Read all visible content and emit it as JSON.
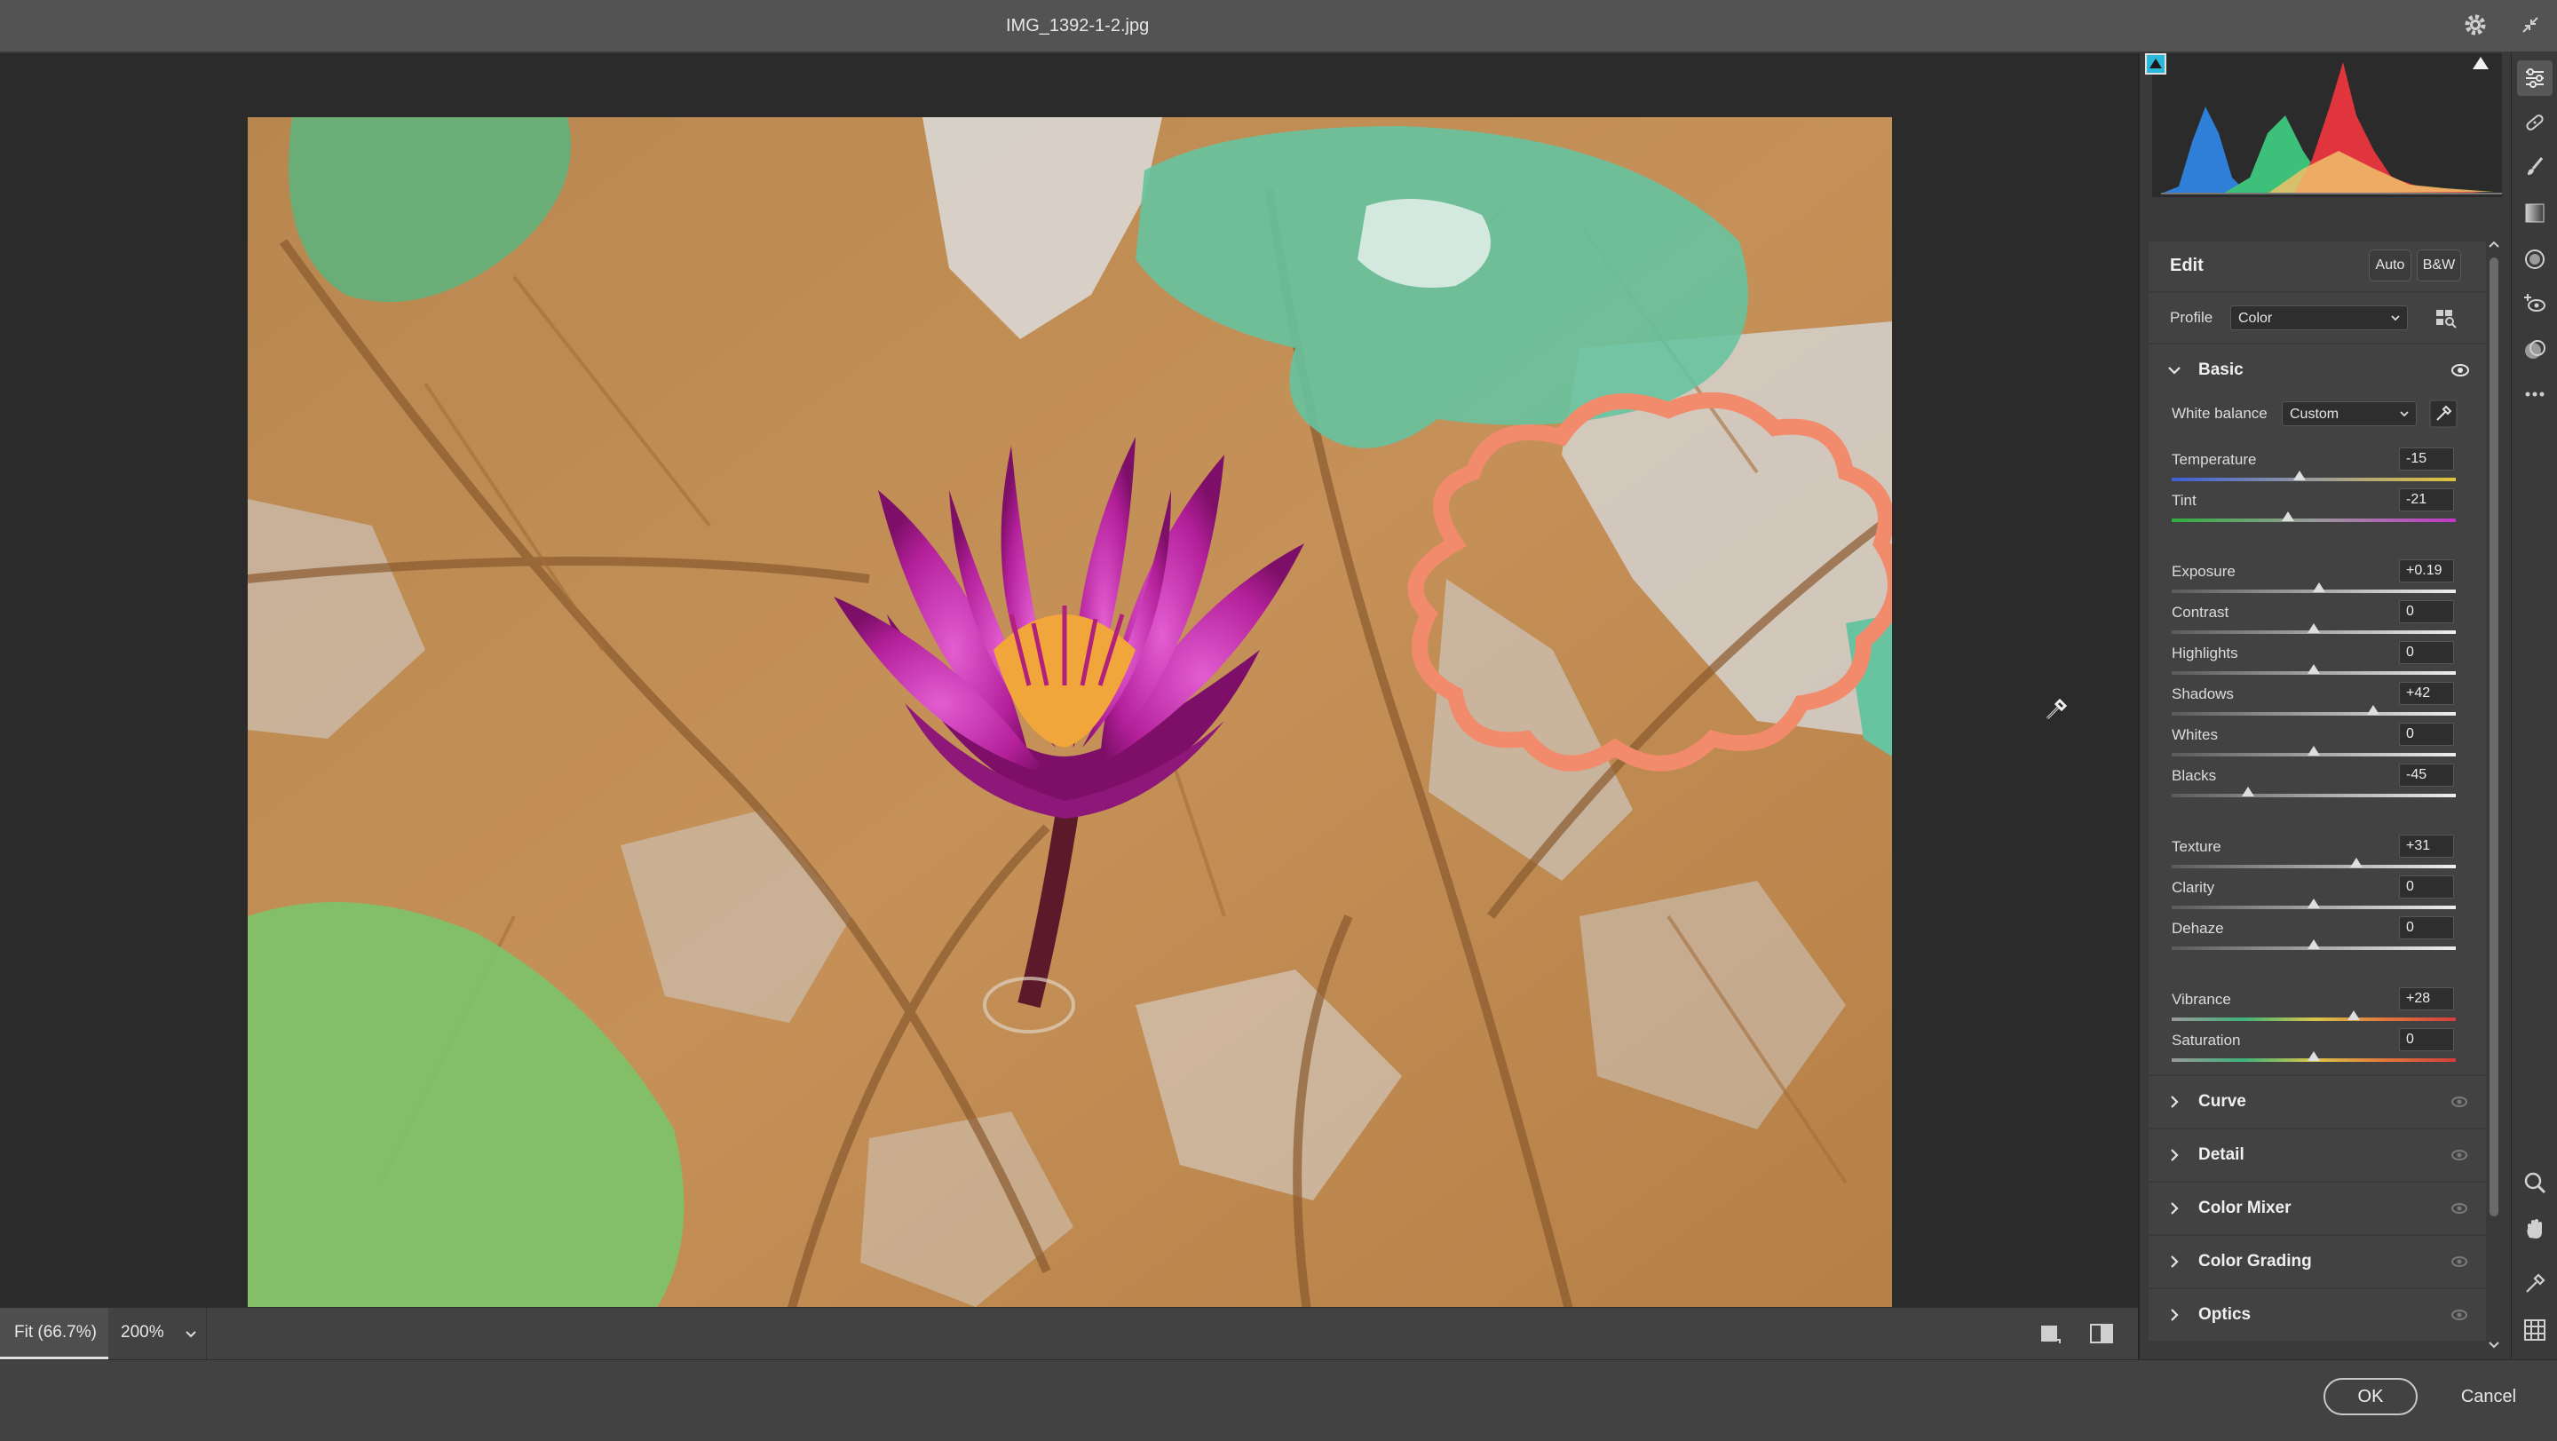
{
  "window": {
    "title": "IMG_1392-1-2.jpg"
  },
  "panel": {
    "edit": {
      "title": "Edit",
      "auto_label": "Auto",
      "bw_label": "B&W"
    },
    "profile": {
      "label": "Profile",
      "value": "Color"
    },
    "basic": {
      "title": "Basic",
      "white_balance": {
        "label": "White balance",
        "value": "Custom"
      },
      "sliders": [
        {
          "label": "Temperature",
          "value": "-15",
          "position": 0.45,
          "gradient": "temp"
        },
        {
          "label": "Tint",
          "value": "-21",
          "position": 0.41,
          "gradient": "tint"
        },
        {
          "label": "Exposure",
          "value": "+0.19",
          "position": 0.52,
          "gradient": "gray"
        },
        {
          "label": "Contrast",
          "value": "0",
          "position": 0.5,
          "gradient": "gray"
        },
        {
          "label": "Highlights",
          "value": "0",
          "position": 0.5,
          "gradient": "gray"
        },
        {
          "label": "Shadows",
          "value": "+42",
          "position": 0.71,
          "gradient": "gray"
        },
        {
          "label": "Whites",
          "value": "0",
          "position": 0.5,
          "gradient": "gray"
        },
        {
          "label": "Blacks",
          "value": "-45",
          "position": 0.27,
          "gradient": "gray"
        },
        {
          "label": "Texture",
          "value": "+31",
          "position": 0.65,
          "gradient": "gray"
        },
        {
          "label": "Clarity",
          "value": "0",
          "position": 0.5,
          "gradient": "gray"
        },
        {
          "label": "Dehaze",
          "value": "0",
          "position": 0.5,
          "gradient": "gray"
        },
        {
          "label": "Vibrance",
          "value": "+28",
          "position": 0.64,
          "gradient": "color"
        },
        {
          "label": "Saturation",
          "value": "0",
          "position": 0.5,
          "gradient": "color"
        }
      ]
    },
    "sections": [
      {
        "title": "Curve"
      },
      {
        "title": "Detail"
      },
      {
        "title": "Color Mixer"
      },
      {
        "title": "Color Grading"
      },
      {
        "title": "Optics"
      }
    ]
  },
  "zoom": {
    "fit_label": "Fit (66.7%)",
    "zoom_label": "200%"
  },
  "footer": {
    "ok_label": "OK",
    "cancel_label": "Cancel"
  },
  "tools": [
    "edit-sliders-icon",
    "healing-icon",
    "brush-icon",
    "linear-gradient-icon",
    "radial-gradient-icon",
    "redeye-icon",
    "presets-icon",
    "more-icon",
    "zoom-icon",
    "hand-icon",
    "color-sampler-icon",
    "grid-icon"
  ],
  "colors": {
    "accent_histogram_blue": "#2f7ed8",
    "accent_histogram_red": "#e0353d",
    "accent_histogram_green": "#3cc07a",
    "annotation_orange": "#f28a6c"
  }
}
